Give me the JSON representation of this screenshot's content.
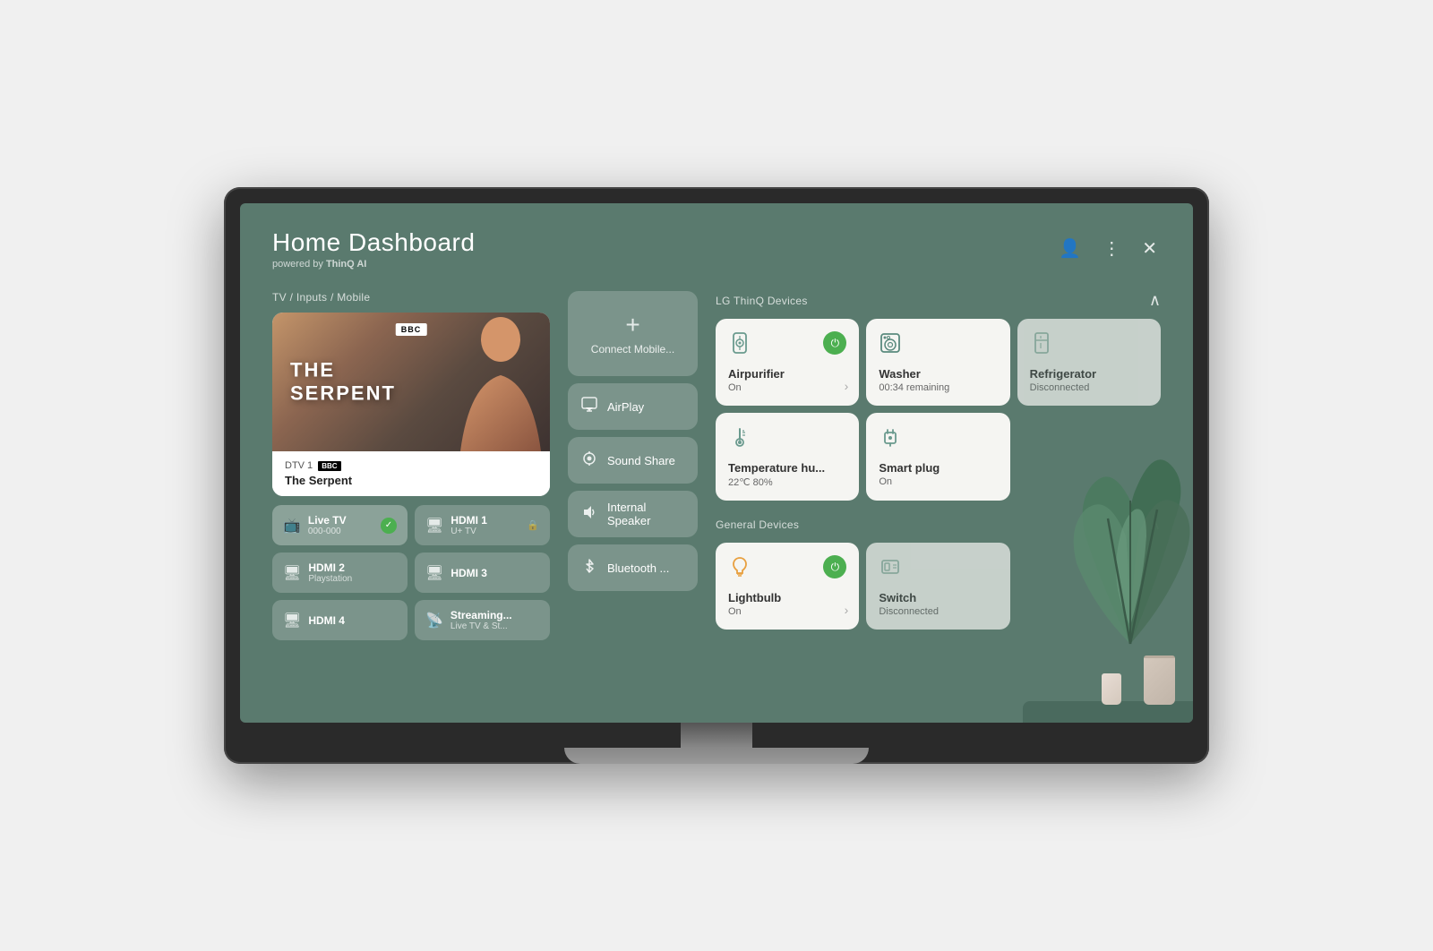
{
  "header": {
    "title": "Home Dashboard",
    "subtitle": "powered by",
    "subtitle_brand": "ThinQ AI",
    "profile_icon": "👤",
    "menu_icon": "⋮",
    "close_icon": "✕"
  },
  "tv_inputs": {
    "section_label": "TV / Inputs / Mobile",
    "preview": {
      "channel": "DTV 1",
      "bbc_text": "BBC",
      "show": "The Serpent",
      "show_title_line1": "THE",
      "show_title_line2": "SERPENT"
    },
    "inputs": [
      {
        "id": "live-tv",
        "name": "Live TV",
        "sub": "000-000",
        "active": true,
        "locked": false
      },
      {
        "id": "hdmi1",
        "name": "HDMI 1",
        "sub": "U+ TV",
        "active": false,
        "locked": true
      },
      {
        "id": "hdmi2",
        "name": "HDMI 2",
        "sub": "Playstation",
        "active": false,
        "locked": false
      },
      {
        "id": "hdmi3",
        "name": "HDMI 3",
        "sub": "",
        "active": false,
        "locked": false
      },
      {
        "id": "hdmi4",
        "name": "HDMI 4",
        "sub": "",
        "active": false,
        "locked": false
      },
      {
        "id": "streaming",
        "name": "Streaming...",
        "sub": "Live TV & St...",
        "active": false,
        "locked": false
      }
    ]
  },
  "mobile_panel": {
    "connect_label": "Connect Mobile...",
    "buttons": [
      {
        "id": "airplay",
        "label": "AirPlay",
        "icon": "▷"
      },
      {
        "id": "sound-share",
        "label": "Sound Share",
        "icon": "🔊"
      },
      {
        "id": "internal-speaker",
        "label": "Internal Speaker",
        "icon": "🔈"
      },
      {
        "id": "bluetooth",
        "label": "Bluetooth ...",
        "icon": "🔵"
      }
    ]
  },
  "lg_thinq": {
    "section_label": "LG ThinQ Devices",
    "devices": [
      {
        "id": "airpurifier",
        "name": "Airpurifier",
        "status": "On",
        "icon": "💨",
        "power": true,
        "disconnected": false
      },
      {
        "id": "washer",
        "name": "Washer",
        "status": "00:34 remaining",
        "icon": "🫧",
        "power": false,
        "disconnected": false
      },
      {
        "id": "refrigerator",
        "name": "Refrigerator",
        "status": "Disconnected",
        "icon": "🧊",
        "power": false,
        "disconnected": true
      },
      {
        "id": "temperature",
        "name": "Temperature hu...",
        "status": "22℃ 80%",
        "icon": "🌡️",
        "power": false,
        "disconnected": false
      },
      {
        "id": "smart-plug",
        "name": "Smart plug",
        "status": "On",
        "icon": "🔌",
        "power": false,
        "disconnected": false
      }
    ]
  },
  "general_devices": {
    "section_label": "General Devices",
    "devices": [
      {
        "id": "lightbulb",
        "name": "Lightbulb",
        "status": "On",
        "icon": "💡",
        "power": true,
        "disconnected": false
      },
      {
        "id": "switch",
        "name": "Switch",
        "status": "Disconnected",
        "icon": "🔲",
        "power": false,
        "disconnected": true
      }
    ]
  }
}
